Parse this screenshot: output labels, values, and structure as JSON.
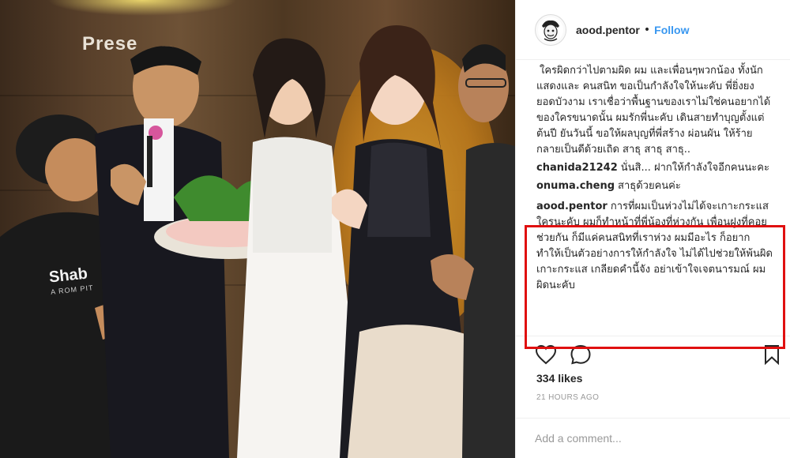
{
  "photo": {
    "banner_text": "Prese",
    "shirt_text": "Shab",
    "shirt_subtext": "A ROM PIT"
  },
  "post": {
    "username": "aood.pentor",
    "separator": "•",
    "follow_label": "Follow"
  },
  "comments": [
    {
      "user": "",
      "text": "ใครผิดกว่าไปตามผิด ผม และเพื่อนๆพวกน้อง ทั้งนักแสดงและ คนสนิท ขอเป็นกำลังใจให้นะคับ พี่ยิ่งยง ยอดบัวงาม เราเชื่อว่าพื้นฐานของเราไม่ใช่คนอยากได้ของใครขนาดนั้น ผมรักพี่นะคับ เดินสายทำบุญตั้งแต่ต้นปี ยันวันนี้ ขอให้ผลบุญที่พี่สร้าง ผ่อนผัน ให้ร้าย กลายเป็นดีด้วยเถิด สาธุ สาธุ สาธุ.."
    },
    {
      "user": "chanida21242",
      "text": "นั่นสิ... ฝากให้กำลังใจอีกคนนะคะ"
    },
    {
      "user": "onuma.cheng",
      "text": "สาธุด้วยคนค่ะ"
    },
    {
      "user": "aood.pentor",
      "text": "การที่ผมเป็นห่วงไม่ได้จะเกาะกระแสใครนะคับ ผมก็ทำหน้าที่พี่น้องที่ห่วงกัน เพื่อนฝูงที่คอยช่วยกัน ก็มีแค่คนสนิทที่เราห่วง ผมมีอะไร ก็อยากทำให้เป็นตัวอย่างการให้กำลังใจ ไม่ได้ไปช่วยให้พ้นผิด เกาะกระแส เกลียดคำนี้จัง อย่าเข้าใจเจตนารมณ์ ผมผิดนะคับ"
    }
  ],
  "actions": {
    "likes": "334 likes",
    "time": "21 HOURS AGO",
    "comment_placeholder": "Add a comment..."
  },
  "colors": {
    "link": "#3897f0",
    "highlight": "#e01010",
    "text": "#262626",
    "muted": "#999999"
  },
  "icons": [
    "heart-icon",
    "comment-bubble-icon",
    "bookmark-icon"
  ]
}
